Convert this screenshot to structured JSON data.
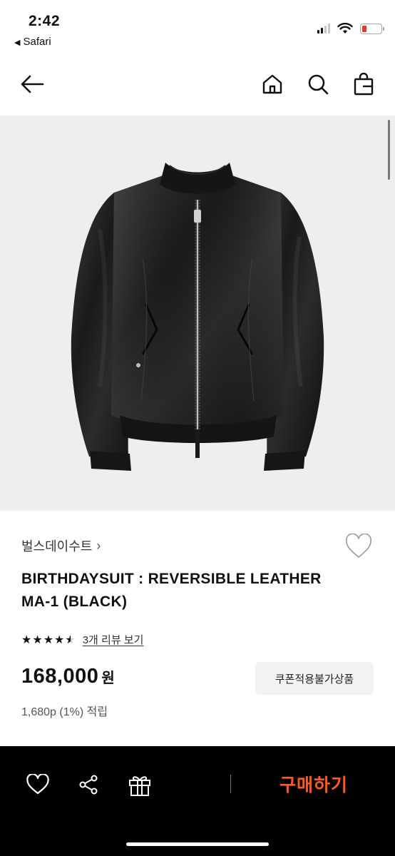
{
  "status_bar": {
    "time": "2:42",
    "back_app": "Safari",
    "battery_color": "#e8392b"
  },
  "nav": {
    "icons": [
      "arrow-left-icon",
      "home-icon",
      "search-icon",
      "bag-icon"
    ]
  },
  "product": {
    "image_description": "black leather jacket",
    "brand": "벌스데이수트",
    "title": "BIRTHDAYSUIT : REVERSIBLE LEATHER MA-1 (BLACK)",
    "rating": 4.5,
    "review_link": "3개 리뷰 보기",
    "price": "168,000",
    "price_unit": "원",
    "points": "1,680p (1%) 적립",
    "coupon_badge": "쿠폰적용불가상품"
  },
  "bottom_bar": {
    "icons": [
      "heart-icon",
      "share-icon",
      "gift-icon"
    ],
    "buy_label": "구매하기",
    "buy_color": "#ff5a1f"
  }
}
